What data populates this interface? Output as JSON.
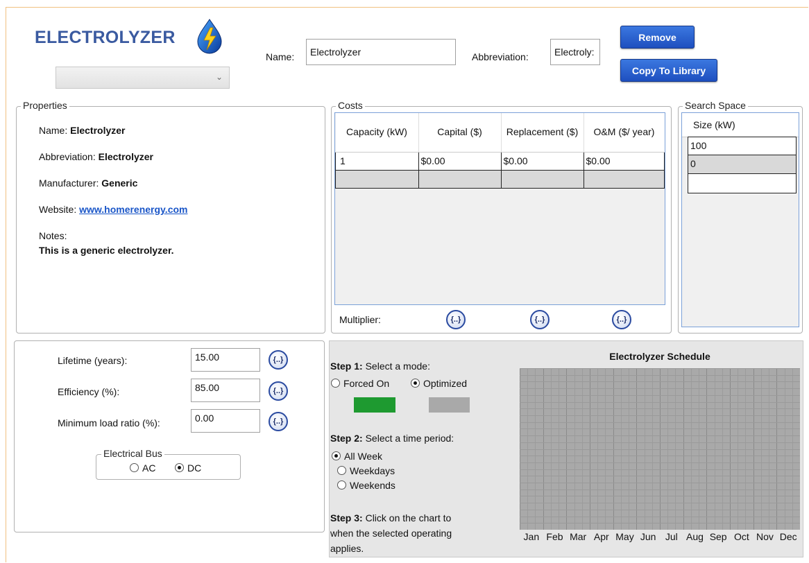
{
  "header": {
    "title": "ELECTROLYZER",
    "name_label": "Name:",
    "name_value": "Electrolyzer",
    "abbreviation_label": "Abbreviation:",
    "abbreviation_value": "Electroly:",
    "remove_label": "Remove",
    "copy_label": "Copy To Library",
    "combo_value": ""
  },
  "properties": {
    "legend": "Properties",
    "name_label": "Name:",
    "name_value": "Electrolyzer",
    "abbr_label": "Abbreviation:",
    "abbr_value": "Electrolyzer",
    "manufacturer_label": "Manufacturer:",
    "manufacturer_value": "Generic",
    "website_label": "Website:",
    "website_value": "www.homerenergy.com",
    "notes_label": "Notes:",
    "notes_value": "This is a generic electrolyzer."
  },
  "costs": {
    "legend": "Costs",
    "headers": [
      "Capacity (kW)",
      "Capital ($)",
      "Replacement ($)",
      "O&M ($/ year)"
    ],
    "rows": [
      [
        "1",
        "$0.00",
        "$0.00",
        "$0.00"
      ]
    ],
    "multiplier_label": "Multiplier:",
    "mult_icon": "{..}"
  },
  "search_space": {
    "legend": "Search Space",
    "header": "Size (kW)",
    "values": [
      "100",
      "0",
      ""
    ]
  },
  "params": {
    "lifetime_label": "Lifetime (years):",
    "lifetime_value": "15.00",
    "efficiency_label": "Efficiency (%):",
    "efficiency_value": "85.00",
    "minload_label": "Minimum load ratio (%):",
    "minload_value": "0.00",
    "bus_legend": "Electrical Bus",
    "bus_ac": "AC",
    "bus_dc": "DC",
    "bus_selected": "DC"
  },
  "schedule": {
    "step1_bold": "Step 1:",
    "step1_text": "Select a mode:",
    "mode_forced": "Forced On",
    "mode_optimized": "Optimized",
    "step2_bold": "Step 2:",
    "step2_text": "Select a time period:",
    "period_allweek": "All Week",
    "period_weekdays": "Weekdays",
    "period_weekends": "Weekends",
    "step3_bold": "Step 3:",
    "step3_line1": "Click on the chart to",
    "step3_line2": "when the selected operating",
    "step3_line3": "applies.",
    "chart_title": "Electrolyzer Schedule",
    "months": [
      "Jan",
      "Feb",
      "Mar",
      "Apr",
      "May",
      "Jun",
      "Jul",
      "Aug",
      "Sep",
      "Oct",
      "Nov",
      "Dec"
    ],
    "colors": {
      "forced": "#1e9a30",
      "optimized": "#a9a9a9"
    }
  }
}
